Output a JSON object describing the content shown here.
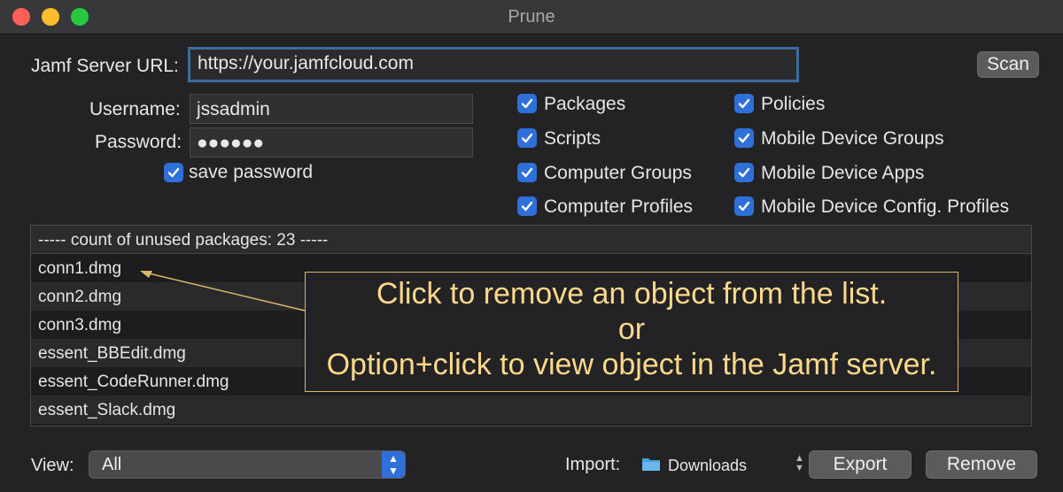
{
  "window": {
    "title": "Prune"
  },
  "server": {
    "label": "Jamf Server URL:",
    "value": "https://your.jamfcloud.com"
  },
  "scan_label": "Scan",
  "credentials": {
    "username_label": "Username:",
    "username_value": "jssadmin",
    "password_label": "Password:",
    "password_value": "●●●●●●",
    "save_password_label": "save password"
  },
  "options": {
    "left": [
      "Packages",
      "Scripts",
      "Computer Groups",
      "Computer Profiles"
    ],
    "right": [
      "Policies",
      "Mobile Device Groups",
      "Mobile Device Apps",
      "Mobile Device Config. Profiles"
    ]
  },
  "list": {
    "header": "----- count of unused packages: 23 -----",
    "items": [
      "conn1.dmg",
      "conn2.dmg",
      "conn3.dmg",
      "essent_BBEdit.dmg",
      "essent_CodeRunner.dmg",
      "essent_Slack.dmg"
    ]
  },
  "callout": {
    "line1": "Click to remove an object from the list.",
    "line2": "or",
    "line3": "Option+click to view object in the Jamf server."
  },
  "footer": {
    "view_label": "View:",
    "view_value": "All",
    "import_label": "Import:",
    "import_value": "Downloads",
    "export_label": "Export",
    "remove_label": "Remove"
  },
  "colors": {
    "accent": "#2f6fd9",
    "callout": "#ffd98a"
  },
  "icons": {
    "folder": "folder-icon",
    "check": "checkmark-icon"
  }
}
